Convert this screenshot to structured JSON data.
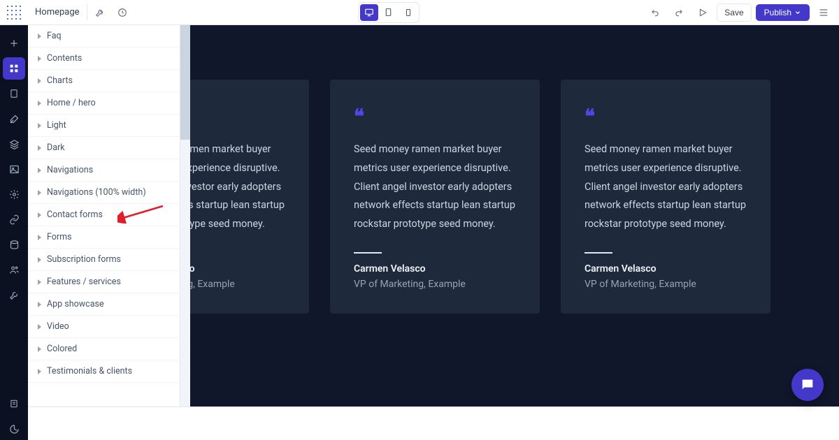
{
  "header": {
    "page_name": "Homepage",
    "save_label": "Save",
    "publish_label": "Publish"
  },
  "panel": {
    "items": [
      "Faq",
      "Contents",
      "Charts",
      "Home / hero",
      "Light",
      "Dark",
      "Navigations",
      "Navigations (100% width)",
      "Contact forms",
      "Forms",
      "Subscription forms",
      "Features / services",
      "App showcase",
      "Video",
      "Colored",
      "Testimonials & clients"
    ]
  },
  "testimonials": [
    {
      "text": "Seed money ramen market buyer metrics user experience disruptive. Client angel investor early adopters network effects startup lean startup rockstar prototype seed money.",
      "name": "Carmen Velasco",
      "role": "VP of Marketing, Example"
    },
    {
      "text": "Seed money ramen market buyer metrics user experience disruptive. Client angel investor early adopters network effects startup lean startup rockstar prototype seed money.",
      "name": "Carmen Velasco",
      "role": "VP of Marketing, Example"
    },
    {
      "text": "Seed money ramen market buyer metrics user experience disruptive. Client angel investor early adopters network effects startup lean startup rockstar prototype seed money.",
      "name": "Carmen Velasco",
      "role": "VP of Marketing, Example"
    }
  ]
}
